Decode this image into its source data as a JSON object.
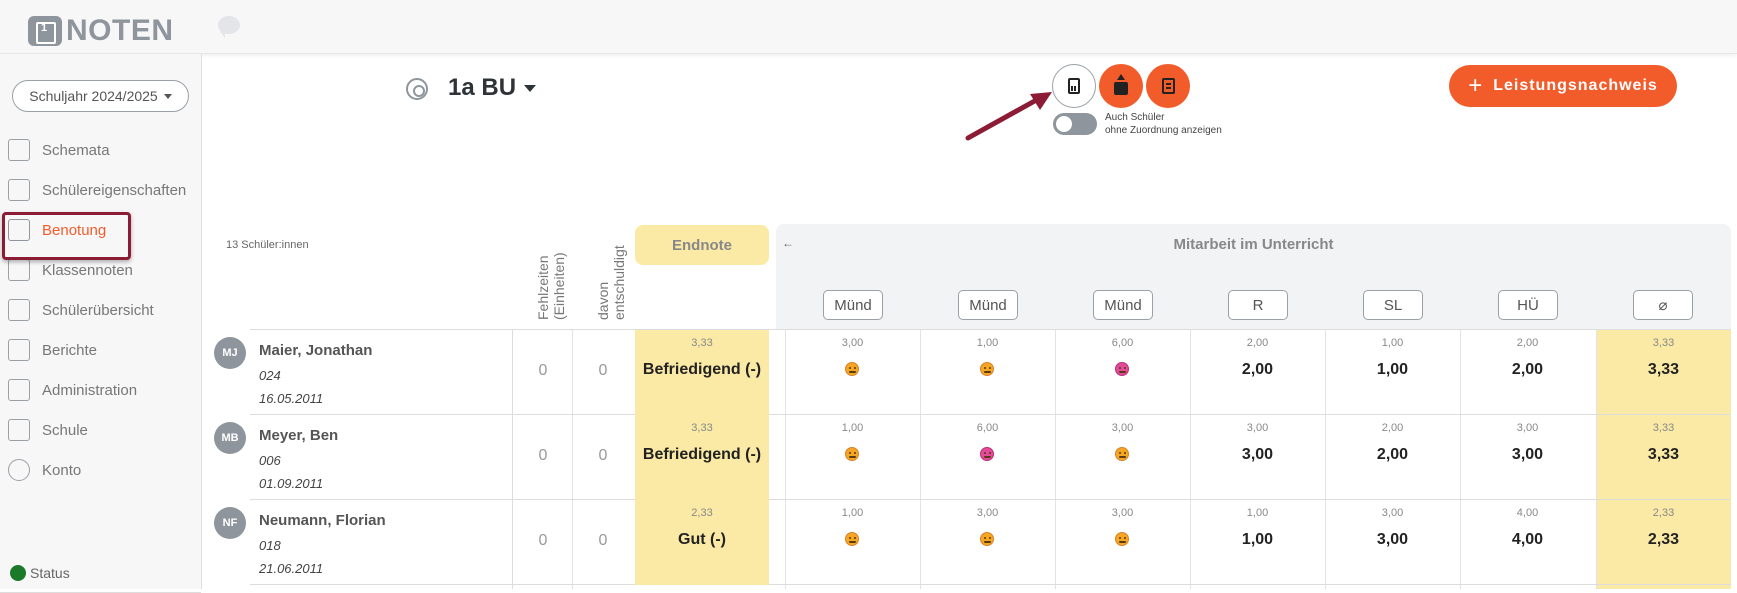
{
  "app": {
    "title": "NOTEN"
  },
  "sidebar": {
    "year_select": "Schuljahr 2024/2025",
    "items": [
      {
        "label": "Schemata",
        "icon": "schema-icon"
      },
      {
        "label": "Schülereigenschaften",
        "icon": "properties-icon"
      },
      {
        "label": "Benotung",
        "icon": "grading-icon",
        "active": true
      },
      {
        "label": "Klassennoten",
        "icon": "class-grades-icon"
      },
      {
        "label": "Schülerübersicht",
        "icon": "student-overview-icon"
      },
      {
        "label": "Berichte",
        "icon": "reports-icon"
      },
      {
        "label": "Administration",
        "icon": "administration-icon"
      },
      {
        "label": "Schule",
        "icon": "school-icon"
      },
      {
        "label": "Konto",
        "icon": "account-icon"
      }
    ],
    "status_label": "Status"
  },
  "header": {
    "class_name": "1a BU",
    "toggle_label_line1": "Auch Schüler",
    "toggle_label_line2": "ohne Zuordnung anzeigen",
    "add_button": "Leistungsnachweis"
  },
  "table": {
    "student_count": "13 Schüler:innen",
    "col_absence": "Fehlzeiten (Einheiten)",
    "col_excused": "davon entschuldigt",
    "col_final": "Endnote",
    "group_title": "Mitarbeit im Unterricht",
    "columns": [
      "Münd",
      "Münd",
      "Münd",
      "R",
      "SL",
      "HÜ",
      "⌀"
    ],
    "rows": [
      {
        "initials": "MJ",
        "name": "Maier, Jonathan",
        "number": "024",
        "dob": "16.05.2011",
        "absences": "0",
        "excused": "0",
        "final_avg": "3,33",
        "final_grade": "Befriedigend (-)",
        "small": [
          "3,00",
          "1,00",
          "6,00",
          "2,00",
          "1,00",
          "2,00",
          "3,33"
        ],
        "big": [
          "",
          "",
          "",
          "2,00",
          "1,00",
          "2,00",
          "3,33"
        ]
      },
      {
        "initials": "MB",
        "name": "Meyer, Ben",
        "number": "006",
        "dob": "01.09.2011",
        "absences": "0",
        "excused": "0",
        "final_avg": "3,33",
        "final_grade": "Befriedigend (-)",
        "small": [
          "1,00",
          "6,00",
          "3,00",
          "3,00",
          "2,00",
          "3,00",
          "3,33"
        ],
        "big": [
          "",
          "",
          "",
          "3,00",
          "2,00",
          "3,00",
          "3,33"
        ]
      },
      {
        "initials": "NF",
        "name": "Neumann, Florian",
        "number": "018",
        "dob": "21.06.2011",
        "absences": "0",
        "excused": "0",
        "final_avg": "2,33",
        "final_grade": "Gut (-)",
        "small": [
          "1,00",
          "3,00",
          "3,00",
          "1,00",
          "3,00",
          "4,00",
          "2,33"
        ],
        "big": [
          "",
          "",
          "",
          "1,00",
          "3,00",
          "4,00",
          "2,33"
        ]
      }
    ]
  },
  "colors": {
    "accent": "#f25c2b",
    "final_bg": "#fbeaa6",
    "annotation": "#8c1b35"
  }
}
